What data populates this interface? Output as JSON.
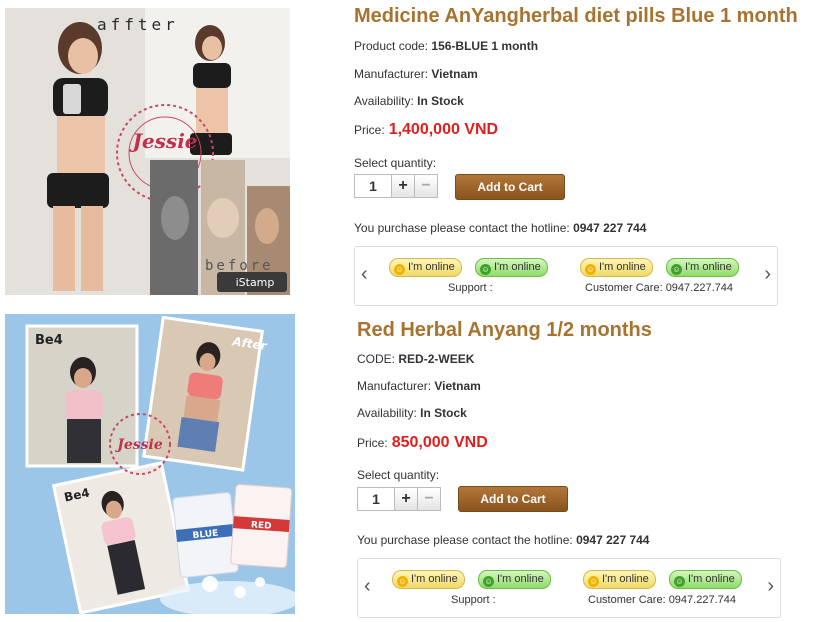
{
  "products": [
    {
      "title": "Medicine AnYangherbal diet pills Blue 1 month",
      "code_label": "Product code:",
      "code_value": "156-BLUE 1 month",
      "manufacturer_label": "Manufacturer:",
      "manufacturer_value": "Vietnam",
      "availability_label": "Availability:",
      "availability_value": "In Stock",
      "price_label": "Price:",
      "price_value": "1,400,000 VND",
      "qty_label": "Select quantity:",
      "qty_value": "1",
      "plus": "+",
      "minus": "−",
      "add_to_cart": "Add to Cart",
      "hotline_label": "You purchase please contact the hotline:",
      "hotline_value": "0947 227 744",
      "badges": [
        "I'm online",
        "I'm online",
        "I'm online",
        "I'm online"
      ],
      "support_label": "Support :",
      "care_label": "Customer Care: 0947.227.744",
      "image_text_top": "affter",
      "image_text_bottom": "before",
      "stamp_text": "Jessie",
      "istamp": "iStamp"
    },
    {
      "title": "Red Herbal Anyang 1/2 months",
      "code_label": "CODE:",
      "code_value": "RED-2-WEEK",
      "manufacturer_label": "Manufacturer:",
      "manufacturer_value": "Vietnam",
      "availability_label": "Availability:",
      "availability_value": "In Stock",
      "price_label": "Price:",
      "price_value": "850,000 VND",
      "qty_label": "Select quantity:",
      "qty_value": "1",
      "plus": "+",
      "minus": "−",
      "add_to_cart": "Add to Cart",
      "hotline_label": "You purchase please contact the hotline:",
      "hotline_value": "0947 227 744",
      "badges": [
        "I'm online",
        "I'm online",
        "I'm online",
        "I'm online"
      ],
      "support_label": "Support :",
      "care_label": "Customer Care: 0947.227.744",
      "image_text_be4_1": "Be4",
      "image_text_after": "After",
      "image_text_be4_2": "Be4",
      "stamp_text": "Jessie",
      "pack_blue": "BLUE",
      "pack_red": "RED"
    }
  ],
  "icons": {
    "arrow_left": "chevron-left-icon",
    "arrow_right": "chevron-right-icon",
    "online": "smiley-icon"
  },
  "colors": {
    "title": "#a8722f",
    "price": "#e01e1e",
    "cart_button": "#9a6128"
  }
}
